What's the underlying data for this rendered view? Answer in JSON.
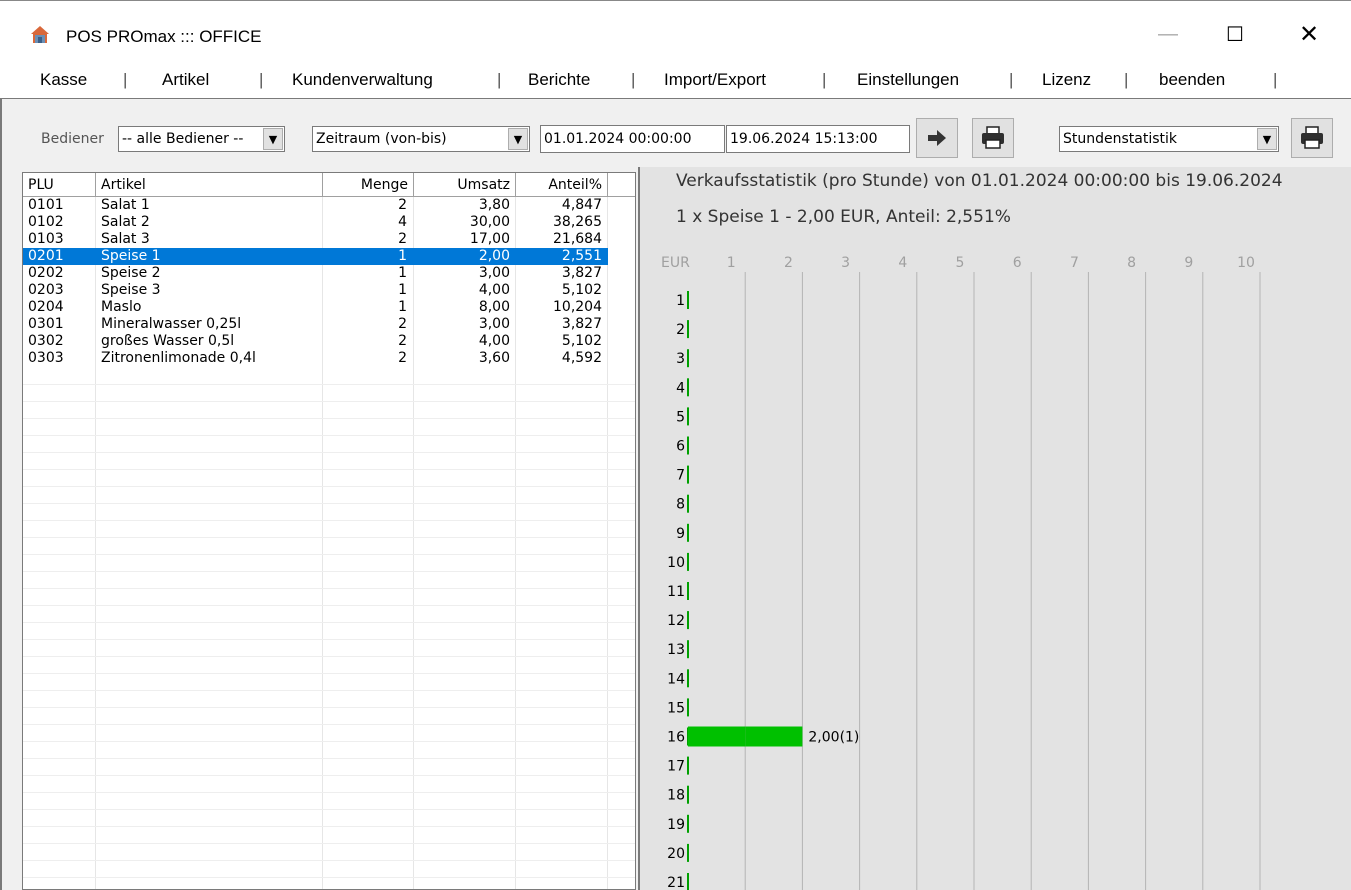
{
  "window": {
    "title": "POS PROmax ::: OFFICE",
    "min": "—",
    "max": "☐",
    "close": "✕"
  },
  "menu": [
    "Kasse",
    "Artikel",
    "Kundenverwaltung",
    "Berichte",
    "Import/Export",
    "Einstellungen",
    "Lizenz",
    "beenden"
  ],
  "toolbar": {
    "bediener_label": "Bediener",
    "bediener_value": "-- alle Bediener --",
    "zeitraum_value": "Zeitraum (von-bis)",
    "date_from": "01.01.2024 00:00:00",
    "date_to": "19.06.2024 15:13:00",
    "report_value": "Stundenstatistik",
    "go_icon": "arrow-right-icon",
    "print_icon": "printer-icon"
  },
  "table": {
    "columns": [
      "PLU",
      "Artikel",
      "Menge",
      "Umsatz",
      "Anteil%"
    ],
    "selected_index": 3,
    "rows": [
      [
        "0101",
        "Salat 1",
        "2",
        "3,80",
        "4,847"
      ],
      [
        "0102",
        "Salat 2",
        "4",
        "30,00",
        "38,265"
      ],
      [
        "0103",
        "Salat 3",
        "2",
        "17,00",
        "21,684"
      ],
      [
        "0201",
        "Speise 1",
        "1",
        "2,00",
        "2,551"
      ],
      [
        "0202",
        "Speise 2",
        "1",
        "3,00",
        "3,827"
      ],
      [
        "0203",
        "Speise 3",
        "1",
        "4,00",
        "5,102"
      ],
      [
        "0204",
        "Maslo",
        "1",
        "8,00",
        "10,204"
      ],
      [
        "0301",
        "Mineralwasser 0,25l",
        "2",
        "3,00",
        "3,827"
      ],
      [
        "0302",
        "großes Wasser 0,5l",
        "2",
        "4,00",
        "5,102"
      ],
      [
        "0303",
        "Zitronenlimonade 0,4l",
        "2",
        "3,60",
        "4,592"
      ]
    ]
  },
  "chart": {
    "title": "Verkaufsstatistik (pro Stunde) von 01.01.2024 00:00:00 bis 19.06.2024",
    "subtitle": "1 x Speise 1 - 2,00 EUR, Anteil: 2,551%",
    "unit_label": "EUR",
    "colors": {
      "bar": "#00c000",
      "grid": "#b4b4b4",
      "axis_tick": "#00a000"
    }
  },
  "chart_data": {
    "type": "bar",
    "orientation": "horizontal",
    "xlabel": "EUR",
    "xticks": [
      1,
      2,
      3,
      4,
      5,
      6,
      7,
      8,
      9,
      10
    ],
    "categories": [
      "1",
      "2",
      "3",
      "4",
      "5",
      "6",
      "7",
      "8",
      "9",
      "10",
      "11",
      "12",
      "13",
      "14",
      "15",
      "16",
      "17",
      "18",
      "19",
      "20",
      "21"
    ],
    "values": [
      0,
      0,
      0,
      0,
      0,
      0,
      0,
      0,
      0,
      0,
      0,
      0,
      0,
      0,
      0,
      2.0,
      0,
      0,
      0,
      0,
      0
    ],
    "data_labels": {
      "16": "2,00(1)"
    },
    "xlim": [
      0,
      10
    ]
  }
}
